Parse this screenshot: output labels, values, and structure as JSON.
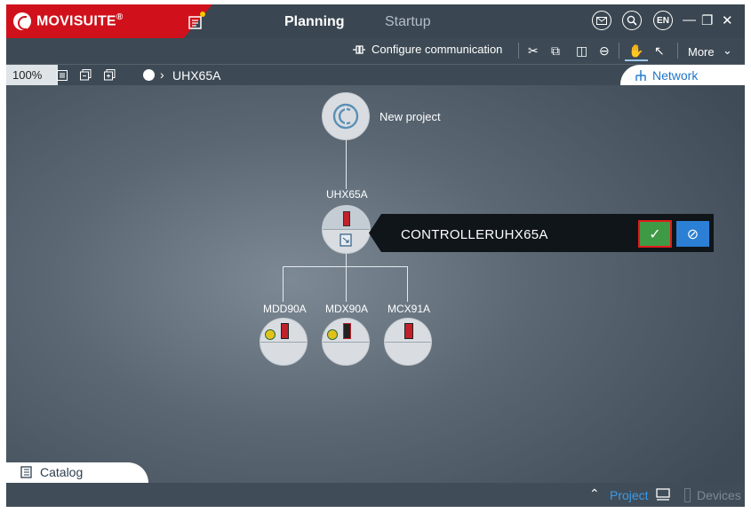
{
  "app": {
    "brand": "MOVISUITE",
    "brand_mark": "®"
  },
  "tabs": {
    "planning": "Planning",
    "startup": "Startup"
  },
  "header": {
    "language": "EN"
  },
  "toolbar": {
    "configure_label": "Configure communication",
    "more_label": "More"
  },
  "breadcrumb": {
    "zoom": "100%",
    "current": "UHX65A",
    "network_tab": "Network"
  },
  "project": {
    "title": "New project"
  },
  "controller": {
    "label": "UHX65A",
    "confirm_text": "CONTROLLERUHX65A"
  },
  "devices": [
    {
      "label": "MDD90A"
    },
    {
      "label": "MDX90A"
    },
    {
      "label": "MCX91A"
    }
  ],
  "bottom": {
    "catalog": "Catalog",
    "project": "Project",
    "devices": "Devices"
  },
  "colors": {
    "brand_red": "#d0111b",
    "accent_blue": "#2b7fd4",
    "confirm_green": "#3f9a45",
    "link_blue": "#1f74c9"
  }
}
